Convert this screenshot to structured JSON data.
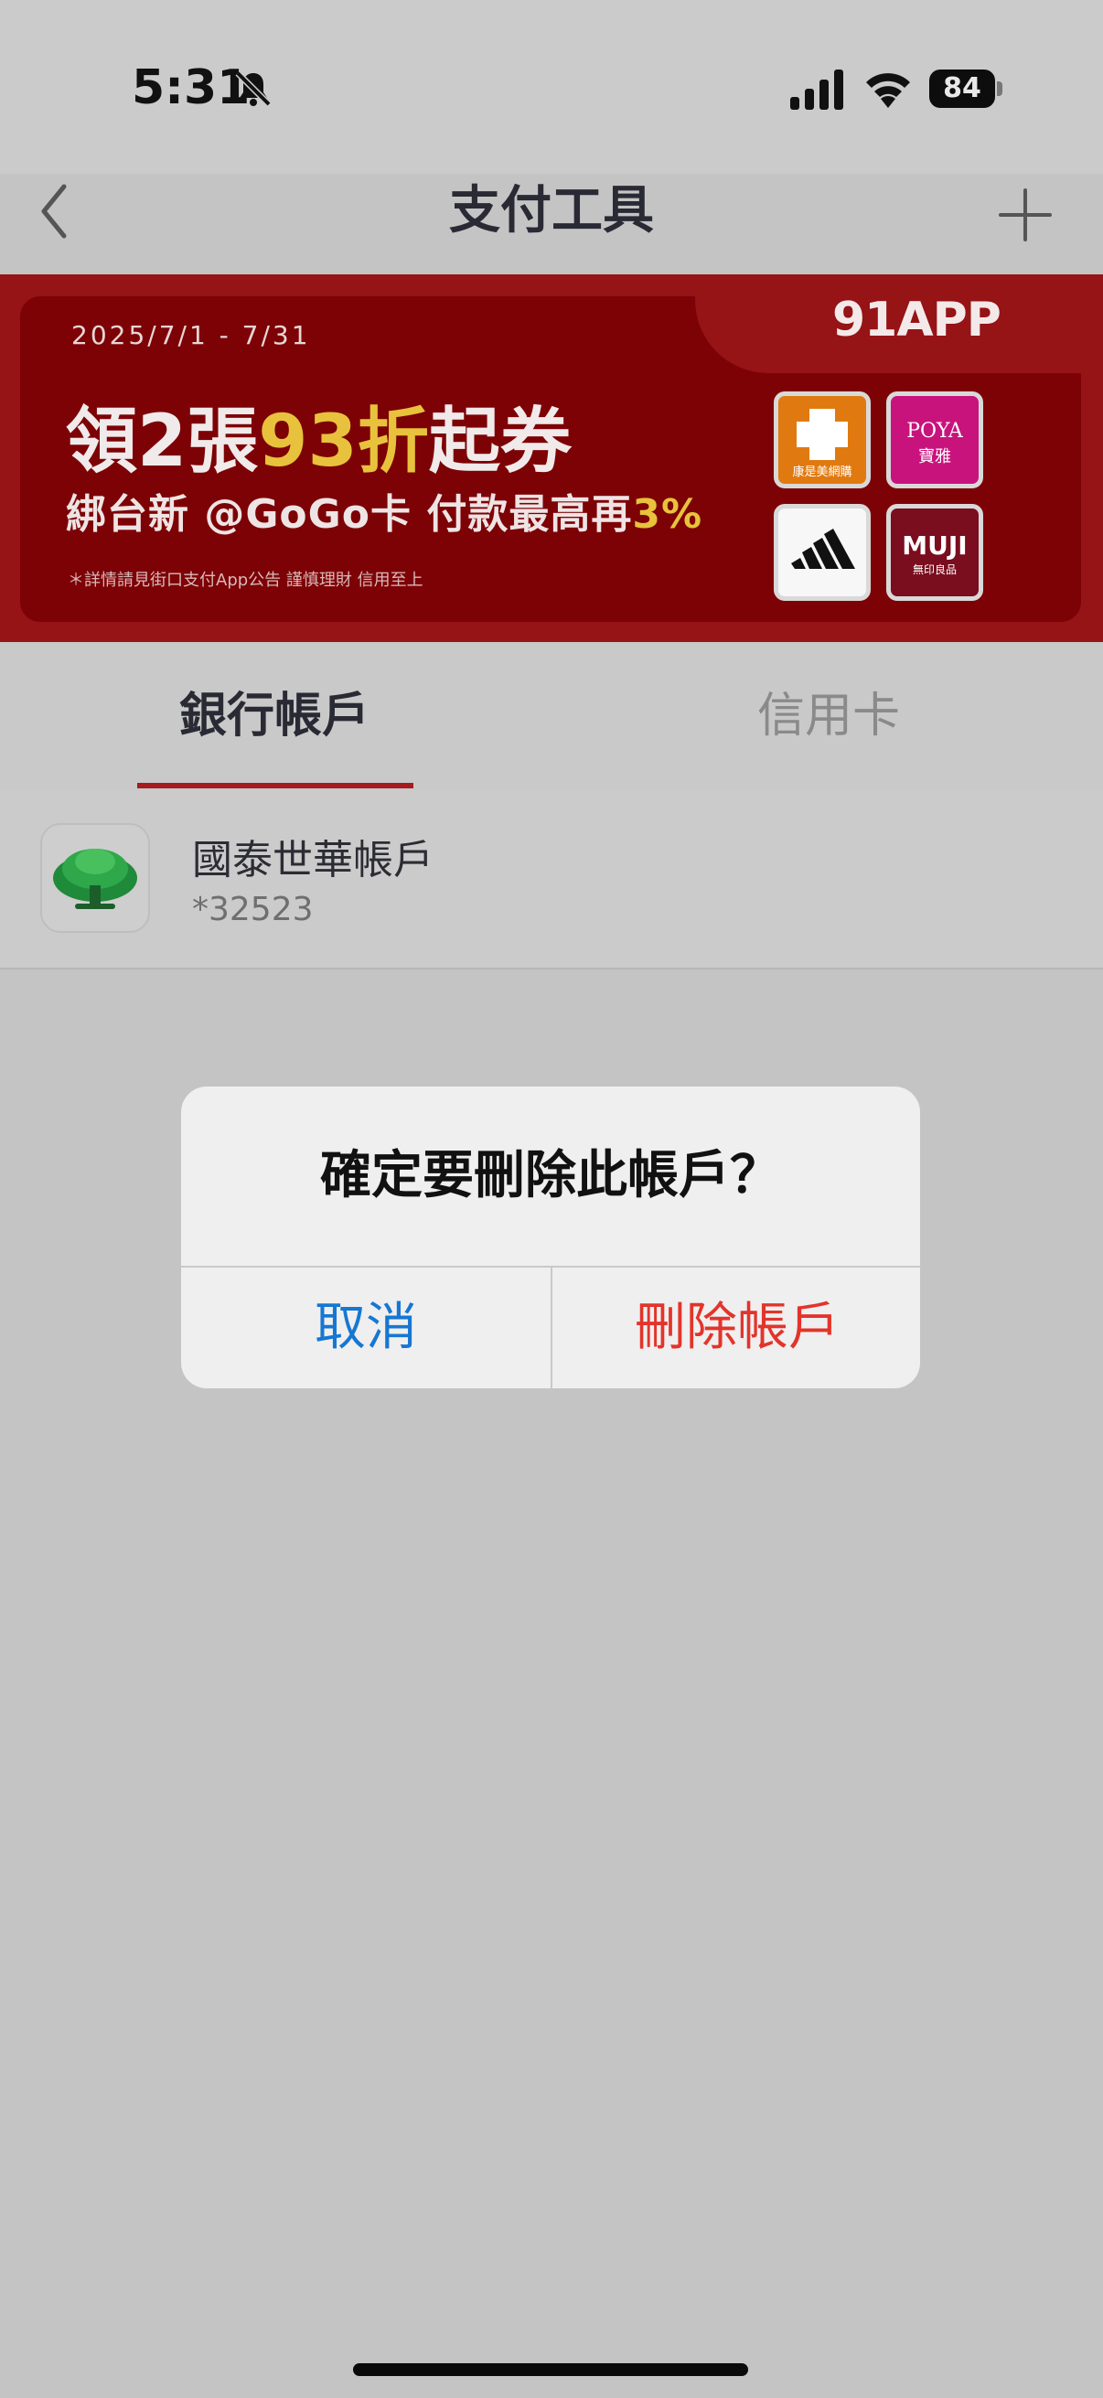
{
  "status_bar": {
    "time": "5:31",
    "battery": "84",
    "icons": [
      "bell-slash-icon",
      "signal-icon",
      "wifi-icon",
      "battery-icon"
    ]
  },
  "header": {
    "title": "支付工具",
    "back_icon": "chevron-left-icon",
    "add_icon": "plus-icon"
  },
  "banner": {
    "brand": "91APP",
    "date": "2025/7/1 - 7/31",
    "headline_a": "領2張",
    "headline_b": "93折",
    "headline_c": "起券",
    "sub_a": "綁台新 @GoGo卡 付款最高再",
    "sub_b": "3%",
    "note": "＊詳情請見街口支付App公告 謹慎理財 信用至上",
    "logos": [
      {
        "name": "康是美網購",
        "color": "#e07a10"
      },
      {
        "name": "POYA 寶雅",
        "line1": "POYA",
        "line2": "寶雅",
        "color": "#c8137d"
      },
      {
        "name": "adidas",
        "color": "#f7f7f7"
      },
      {
        "name": "MUJI 無印良品",
        "line1": "MUJI",
        "line2": "無印良品",
        "color": "#7a0d1e"
      }
    ],
    "more_icon": "double-chevron-right-icon",
    "colors": {
      "background": "#961316",
      "inner": "#7d0206",
      "highlight": "#e8c23c"
    }
  },
  "tabs": [
    {
      "label": "銀行帳戶",
      "active": true
    },
    {
      "label": "信用卡",
      "active": false
    }
  ],
  "accounts": [
    {
      "name": "國泰世華帳戶",
      "number": "*32523",
      "icon": "cathay-tree-logo"
    }
  ],
  "dialog": {
    "title": "確定要刪除此帳戶？",
    "cancel_label": "取消",
    "delete_label": "刪除帳戶",
    "colors": {
      "cancel": "#1677d2",
      "delete": "#e3342b"
    }
  }
}
